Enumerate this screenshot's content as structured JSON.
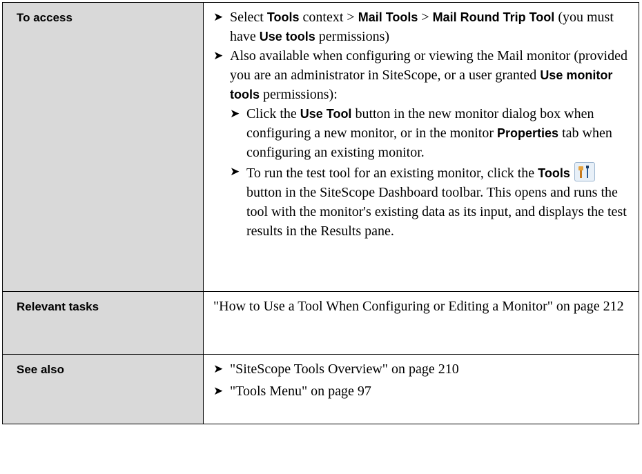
{
  "rows": {
    "access": {
      "label": "To access",
      "item1": {
        "t1": "Select ",
        "b1": "Tools",
        "t2": " context > ",
        "b2": "Mail Tools",
        "t3": " > ",
        "b3": "Mail Round Trip Tool",
        "t4": " (you must have ",
        "b4": "Use tools",
        "t5": " permissions)"
      },
      "item2": {
        "t1": "Also available when configuring or viewing the Mail monitor (provided you are an administrator in SiteScope, or a user granted ",
        "b1": "Use monitor tools",
        "t2": " permissions):"
      },
      "sub1": {
        "t1": "Click the ",
        "b1": "Use Tool",
        "t2": " button in the new monitor dialog box when configuring a new monitor, or in the monitor ",
        "b2": "Properties",
        "t3": " tab when configuring an existing monitor."
      },
      "sub2": {
        "t1": "To run the test tool for an existing monitor, click the ",
        "b1": "Tools",
        "t2": "button in the SiteScope Dashboard toolbar. This opens and runs the tool with the monitor's existing data as its input, and displays the test results in the Results pane."
      }
    },
    "tasks": {
      "label": "Relevant tasks",
      "text": "\"How to Use a Tool When Configuring or Editing a Monitor\" on page 212"
    },
    "see_also": {
      "label": "See also",
      "items": [
        "\"SiteScope Tools Overview\" on page 210",
        "\"Tools Menu\" on page 97"
      ]
    }
  },
  "bullet": "➤",
  "icon": "tools-icon"
}
